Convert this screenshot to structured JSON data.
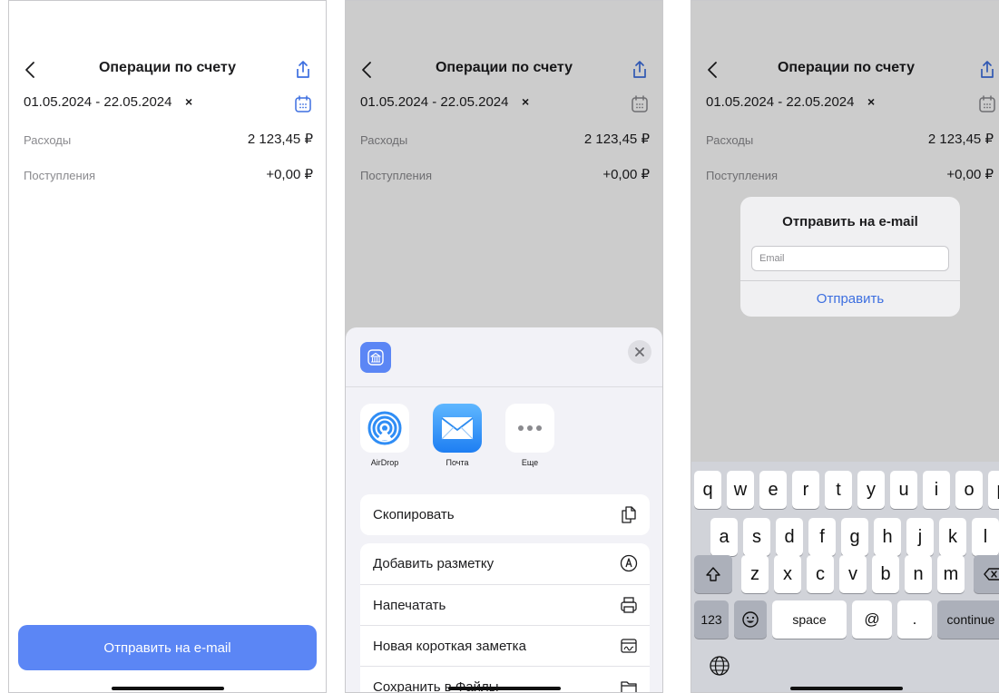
{
  "screens": [
    {
      "nav": {
        "title": "Операции по счету"
      },
      "date_range": "01.05.2024 - 22.05.2024",
      "clear_symbol": "×",
      "summary": [
        {
          "label": "Расходы",
          "value": "2 123,45 ₽"
        },
        {
          "label": "Поступления",
          "value": "+0,00 ₽"
        }
      ],
      "primary_button": "Отправить на e-mail"
    },
    {
      "nav": {
        "title": "Операции по счету"
      },
      "date_range": "01.05.2024 - 22.05.2024",
      "clear_symbol": "×",
      "summary": [
        {
          "label": "Расходы",
          "value": "2 123,45 ₽"
        },
        {
          "label": "Поступления",
          "value": "+0,00 ₽"
        }
      ],
      "share_sheet": {
        "apps": [
          {
            "label": "AirDrop",
            "icon": "airdrop-icon"
          },
          {
            "label": "Почта",
            "icon": "mail-icon"
          },
          {
            "label": "Еще",
            "icon": "more-icon"
          }
        ],
        "actions_primary": [
          {
            "label": "Скопировать",
            "icon": "copy-icon"
          }
        ],
        "actions_secondary": [
          {
            "label": "Добавить разметку",
            "icon": "markup-icon"
          },
          {
            "label": "Напечатать",
            "icon": "print-icon"
          },
          {
            "label": "Новая короткая заметка",
            "icon": "quick-note-icon"
          },
          {
            "label": "Сохранить в Файлы",
            "icon": "folder-icon"
          }
        ]
      }
    },
    {
      "nav": {
        "title": "Операции по счету"
      },
      "date_range": "01.05.2024 - 22.05.2024",
      "clear_symbol": "×",
      "summary": [
        {
          "label": "Расходы",
          "value": "2 123,45 ₽"
        },
        {
          "label": "Поступления",
          "value": "+0,00 ₽"
        }
      ],
      "alert": {
        "title": "Отправить на e-mail",
        "input_placeholder": "Email",
        "button": "Отправить"
      },
      "keyboard": {
        "row1": [
          "q",
          "w",
          "e",
          "r",
          "t",
          "y",
          "u",
          "i",
          "o",
          "p"
        ],
        "row2": [
          "a",
          "s",
          "d",
          "f",
          "g",
          "h",
          "j",
          "k",
          "l"
        ],
        "row3": [
          "z",
          "x",
          "c",
          "v",
          "b",
          "n",
          "m"
        ],
        "key_123": "123",
        "key_space": "space",
        "key_at": "@",
        "key_dot": ".",
        "key_continue": "continue"
      }
    }
  ],
  "colors": {
    "accent": "#5b86f5",
    "link": "#3d6fe0",
    "dim_overlay": "rgba(0,0,0,0.20)",
    "keyboard_bg": "#d1d3d9"
  }
}
